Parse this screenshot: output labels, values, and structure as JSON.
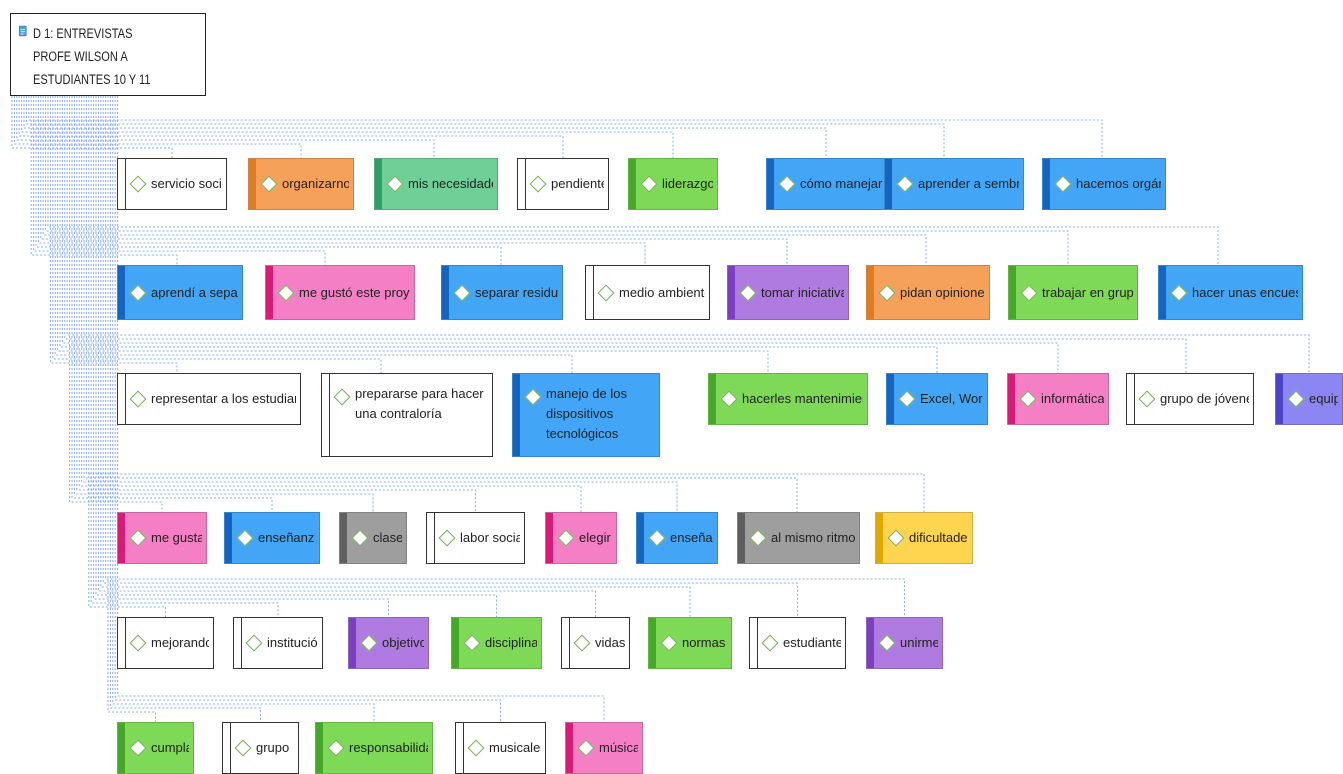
{
  "document": {
    "title": "D 1: ENTREVISTAS PROFE WILSON A ESTUDIANTES 10 Y 11",
    "icon": "document-icon"
  },
  "colors": {
    "white": "#ffffff",
    "orange": "#f6a15a",
    "teal_green": "#6fcf97",
    "green": "#7ed957",
    "blue": "#42a5f5",
    "pink": "#f47fc4",
    "purple": "#b07be0",
    "gray": "#9e9e9e",
    "yellow": "#ffd54f",
    "lavender": "#8c86f2",
    "connector": "#5b8def"
  },
  "codes": [
    {
      "label": "servicio social",
      "color": "white"
    },
    {
      "label": "organizarnos",
      "color": "orange"
    },
    {
      "label": "mis necesidades",
      "color": "teal_green"
    },
    {
      "label": "pendiente",
      "color": "white"
    },
    {
      "label": "liderazgo",
      "color": "green"
    },
    {
      "label": "cómo manejarlos",
      "color": "blue"
    },
    {
      "label": "aprender a sembrar",
      "color": "blue"
    },
    {
      "label": "hacemos orgánico",
      "color": "blue"
    },
    {
      "label": "aprendí a separar",
      "color": "blue"
    },
    {
      "label": "me gustó este proyecto",
      "color": "pink"
    },
    {
      "label": "separar residuos",
      "color": "blue"
    },
    {
      "label": "medio ambiente",
      "color": "white"
    },
    {
      "label": "tomar iniciativa",
      "color": "purple"
    },
    {
      "label": "pidan opiniones",
      "color": "orange"
    },
    {
      "label": "trabajar en grupo",
      "color": "green"
    },
    {
      "label": "hacer unas encuestas",
      "color": "blue"
    },
    {
      "label": "representar a los estudiantes",
      "color": "white"
    },
    {
      "label": "prepararse para hacer una contraloría",
      "color": "white"
    },
    {
      "label": "manejo de los dispositivos tecnológicos",
      "color": "blue"
    },
    {
      "label": "hacerles mantenimiento",
      "color": "green"
    },
    {
      "label": "Excel, Word",
      "color": "blue"
    },
    {
      "label": "informática",
      "color": "pink"
    },
    {
      "label": "grupo de jóvenes",
      "color": "white"
    },
    {
      "label": "equipo",
      "color": "lavender"
    },
    {
      "label": "me gusta",
      "color": "pink"
    },
    {
      "label": "enseñanza",
      "color": "blue"
    },
    {
      "label": "clase",
      "color": "gray"
    },
    {
      "label": "labor social",
      "color": "white"
    },
    {
      "label": "elegir",
      "color": "pink"
    },
    {
      "label": "enseñar",
      "color": "blue"
    },
    {
      "label": "al mismo ritmo",
      "color": "gray"
    },
    {
      "label": "dificultades",
      "color": "yellow"
    },
    {
      "label": "mejorando",
      "color": "white"
    },
    {
      "label": "institución",
      "color": "white"
    },
    {
      "label": "objetivo",
      "color": "purple"
    },
    {
      "label": "disciplina",
      "color": "green"
    },
    {
      "label": "vidas",
      "color": "white"
    },
    {
      "label": "normas",
      "color": "green"
    },
    {
      "label": "estudiantes",
      "color": "white"
    },
    {
      "label": "unirme",
      "color": "purple"
    },
    {
      "label": "cumplan",
      "color": "green"
    },
    {
      "label": "grupo",
      "color": "white"
    },
    {
      "label": "responsabilidad",
      "color": "green"
    },
    {
      "label": "musicales",
      "color": "white"
    },
    {
      "label": "música",
      "color": "pink"
    }
  ]
}
